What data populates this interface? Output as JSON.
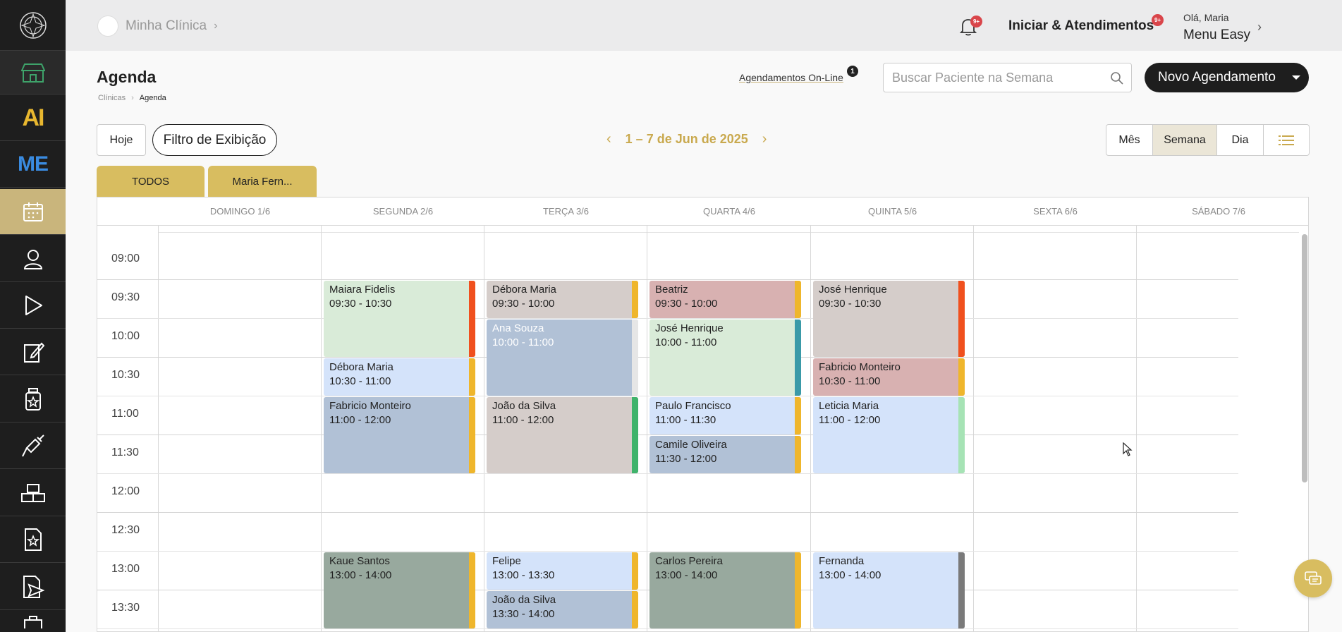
{
  "sidebar": {
    "items": [
      {
        "name": "brand-logo",
        "icon": "logo-emblem"
      },
      {
        "name": "store",
        "icon": "store-icon"
      },
      {
        "name": "ai",
        "text": "AI"
      },
      {
        "name": "me",
        "text": "ME"
      },
      {
        "name": "agenda",
        "icon": "calendar-icon",
        "active": true
      },
      {
        "name": "patients",
        "icon": "user-icon"
      },
      {
        "name": "play",
        "icon": "play-icon"
      },
      {
        "name": "edit-forms",
        "icon": "edit-document-icon"
      },
      {
        "name": "medication",
        "icon": "bottle-star-icon"
      },
      {
        "name": "injection",
        "icon": "syringe-icon"
      },
      {
        "name": "stock",
        "icon": "boxes-icon"
      },
      {
        "name": "favorites-doc",
        "icon": "document-star-icon"
      },
      {
        "name": "send-doc",
        "icon": "document-send-icon"
      }
    ]
  },
  "topbar": {
    "clinic_name": "Minha Clínica",
    "clinic_chevron": "›",
    "bell_badge": "9+",
    "iniciar_label": "Iniciar & Atendimentos",
    "iniciar_badge": "9+",
    "greeting": "Olá, Maria",
    "menu_label": "Menu Easy",
    "user_chevron": "›"
  },
  "header": {
    "title": "Agenda",
    "breadcrumb": [
      "Clínicas",
      "Agenda"
    ],
    "breadcrumb_sep": "›",
    "online_label": "Agendamentos On-Line",
    "online_badge": "1",
    "search_placeholder": "Buscar Paciente na Semana",
    "new_button": "Novo Agendamento"
  },
  "toolbar": {
    "today": "Hoje",
    "filter": "Filtro de Exibição",
    "date_range": "1 – 7 de Jun de 2025",
    "prev": "‹",
    "next": "›",
    "views": [
      {
        "label": "Mês",
        "active": false
      },
      {
        "label": "Semana",
        "active": true
      },
      {
        "label": "Dia",
        "active": false
      }
    ]
  },
  "tabs": [
    "TODOS",
    "Maria Fern..."
  ],
  "calendar": {
    "days": [
      "DOMINGO 1/6",
      "SEGUNDA 2/6",
      "TERÇA 3/6",
      "QUARTA 4/6",
      "QUINTA 5/6",
      "SEXTA 6/6",
      "SÁBADO 7/6"
    ],
    "times": [
      "09:00",
      "09:30",
      "10:00",
      "10:30",
      "11:00",
      "11:30",
      "12:00",
      "12:30",
      "13:00",
      "13:30"
    ],
    "events": [
      {
        "day": 1,
        "start": "09:30",
        "end": "10:30",
        "name": "Maiara Fidelis",
        "time": "09:30 - 10:30",
        "bg": "#d9ebd8",
        "strip": "#f0501e",
        "light": false
      },
      {
        "day": 1,
        "start": "10:30",
        "end": "11:00",
        "name": "Débora Maria",
        "time": "10:30 - 11:00",
        "bg": "#d4e3fa",
        "strip": "#efb62c",
        "light": false
      },
      {
        "day": 1,
        "start": "11:00",
        "end": "12:00",
        "name": "Fabricio Monteiro",
        "time": "11:00 - 12:00",
        "bg": "#b1c1d6",
        "strip": "#efb62c",
        "light": false
      },
      {
        "day": 1,
        "start": "13:00",
        "end": "14:00",
        "name": "Kaue Santos",
        "time": "13:00 - 14:00",
        "bg": "#98a99e",
        "strip": "#efb62c",
        "light": false
      },
      {
        "day": 2,
        "start": "09:30",
        "end": "10:00",
        "name": "Débora Maria",
        "time": "09:30 - 10:00",
        "bg": "#d5cdca",
        "strip": "#efb62c",
        "light": false
      },
      {
        "day": 2,
        "start": "10:00",
        "end": "11:00",
        "name": "Ana Souza",
        "time": "10:00 - 11:00",
        "bg": "#b1c1d6",
        "strip": "#e6e6e6",
        "light": true
      },
      {
        "day": 2,
        "start": "11:00",
        "end": "12:00",
        "name": "João da Silva",
        "time": "11:00 - 12:00",
        "bg": "#d5cdca",
        "strip": "#3fb36b",
        "light": false
      },
      {
        "day": 2,
        "start": "13:00",
        "end": "13:30",
        "name": "Felipe",
        "time": "13:00 - 13:30",
        "bg": "#d4e3fa",
        "strip": "#efb62c",
        "light": false
      },
      {
        "day": 2,
        "start": "13:30",
        "end": "14:00",
        "name": "João da Silva",
        "time": "13:30 - 14:00",
        "bg": "#b1c1d6",
        "strip": "#efb62c",
        "light": false
      },
      {
        "day": 3,
        "start": "09:30",
        "end": "10:00",
        "name": "Beatriz",
        "time": "09:30 - 10:00",
        "bg": "#d8b1b1",
        "strip": "#efb62c",
        "light": false
      },
      {
        "day": 3,
        "start": "10:00",
        "end": "11:00",
        "name": "José Henrique",
        "time": "10:00 - 11:00",
        "bg": "#d9ebd8",
        "strip": "#3a9aa8",
        "light": false
      },
      {
        "day": 3,
        "start": "11:00",
        "end": "11:30",
        "name": "Paulo Francisco",
        "time": "11:00 - 11:30",
        "bg": "#d4e3fa",
        "strip": "#efb62c",
        "light": false
      },
      {
        "day": 3,
        "start": "11:30",
        "end": "12:00",
        "name": "Camile Oliveira",
        "time": "11:30 - 12:00",
        "bg": "#b1c1d6",
        "strip": "#efb62c",
        "light": false
      },
      {
        "day": 3,
        "start": "13:00",
        "end": "14:00",
        "name": "Carlos Pereira",
        "time": "13:00 - 14:00",
        "bg": "#98a99e",
        "strip": "#efb62c",
        "light": false
      },
      {
        "day": 4,
        "start": "09:30",
        "end": "10:30",
        "name": "José Henrique",
        "time": "09:30 - 10:30",
        "bg": "#d5cdca",
        "strip": "#f0501e",
        "light": false
      },
      {
        "day": 4,
        "start": "10:30",
        "end": "11:00",
        "name": "Fabricio Monteiro",
        "time": "10:30 - 11:00",
        "bg": "#d8b1b1",
        "strip": "#efb62c",
        "light": false
      },
      {
        "day": 4,
        "start": "11:00",
        "end": "12:00",
        "name": "Leticia Maria",
        "time": "11:00 - 12:00",
        "bg": "#d4e3fa",
        "strip": "#a6e3b5",
        "light": false
      },
      {
        "day": 4,
        "start": "13:00",
        "end": "14:00",
        "name": "Fernanda",
        "time": "13:00 - 14:00",
        "bg": "#d4e3fa",
        "strip": "#7a7a7a",
        "light": false
      }
    ]
  },
  "colors": {
    "accent": "#d8bd60",
    "accent_text": "#c9a94e",
    "sidebar_bg": "#1e1e1e",
    "sidebar_active": "#c9b57c",
    "badge": "#d9454a"
  }
}
